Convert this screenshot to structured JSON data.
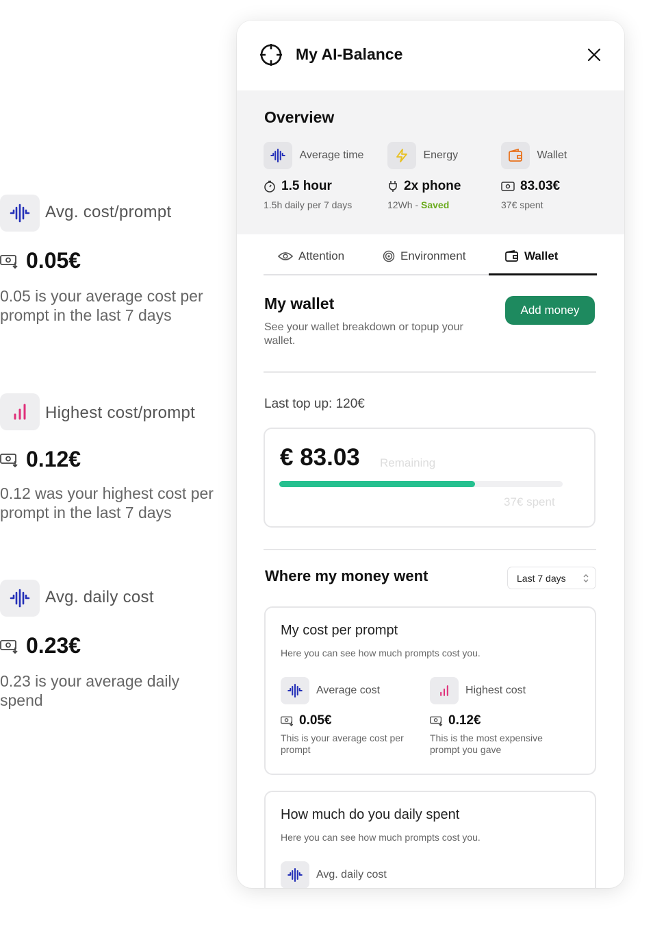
{
  "left": {
    "items": [
      {
        "label": "Avg. cost/prompt",
        "value": "0.05€",
        "desc": "0.05 is your average cost per prompt in the last 7 days",
        "icon": "wave-icon"
      },
      {
        "label": "Highest cost/prompt",
        "value": "0.12€",
        "desc": "0.12 was your highest cost per prompt in the last 7 days",
        "icon": "bar-icon"
      },
      {
        "label": "Avg. daily cost",
        "value": "0.23€",
        "desc": "0.23 is your average daily spend",
        "icon": "wave-icon"
      }
    ]
  },
  "panel": {
    "title": "My AI-Balance",
    "overview": {
      "heading": "Overview",
      "cols": [
        {
          "label": "Average time",
          "value": "1.5 hour",
          "sub": "1.5h daily per 7 days",
          "sub_extra": ""
        },
        {
          "label": "Energy",
          "value": "2x phone",
          "sub": "12Wh - ",
          "sub_extra": "Saved"
        },
        {
          "label": "Wallet",
          "value": "83.03€",
          "sub": "37€ spent",
          "sub_extra": ""
        }
      ]
    },
    "tabs": [
      "Attention",
      "Environment",
      "Wallet"
    ],
    "active_tab": "Wallet",
    "wallet": {
      "title": "My wallet",
      "desc": "See your wallet breakdown or topup your wallet.",
      "add_button": "Add money",
      "last_topup": "Last top up: 120€",
      "balance": "€ 83.03",
      "remaining_label": "Remaining",
      "spent_label": "37€ spent",
      "progress": 0.69
    },
    "money": {
      "title": "Where my money went",
      "period": "Last 7 days",
      "cost_card": {
        "title": "My cost per prompt",
        "desc": "Here you can see how much prompts cost you.",
        "avg_label": "Average cost",
        "avg_value": "0.05€",
        "avg_desc": "This is your average cost per prompt",
        "high_label": "Highest cost",
        "high_value": "0.12€",
        "high_desc": "This is the most expensive prompt you gave"
      },
      "daily_card": {
        "title": "How much do you daily spent",
        "desc": "Here you can see how much prompts cost you.",
        "avg_label": "Avg. daily cost"
      }
    }
  },
  "colors": {
    "accent": "#1e8a5f",
    "progress": "#25c08f",
    "wave": "#2430b8",
    "bar": "#e0307a",
    "energy": "#e8c020",
    "wallet": "#e8731e",
    "saved": "#6aab1e"
  }
}
